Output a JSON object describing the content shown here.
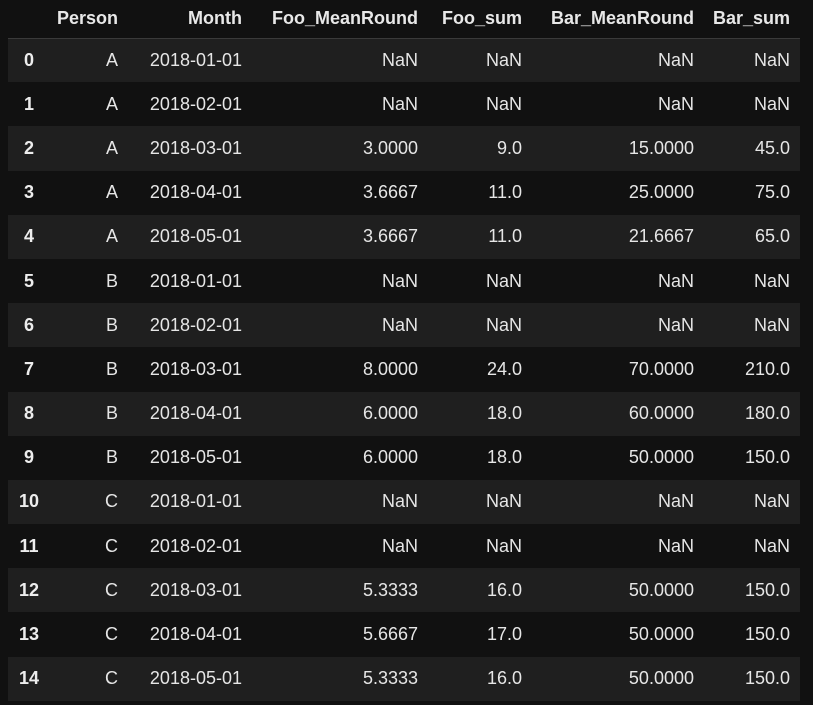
{
  "table": {
    "columns": [
      "",
      "Person",
      "Month",
      "Foo_MeanRound",
      "Foo_sum",
      "Bar_MeanRound",
      "Bar_sum"
    ],
    "rows": [
      {
        "index": "0",
        "cells": [
          "A",
          "2018-01-01",
          "NaN",
          "NaN",
          "NaN",
          "NaN"
        ]
      },
      {
        "index": "1",
        "cells": [
          "A",
          "2018-02-01",
          "NaN",
          "NaN",
          "NaN",
          "NaN"
        ]
      },
      {
        "index": "2",
        "cells": [
          "A",
          "2018-03-01",
          "3.0000",
          "9.0",
          "15.0000",
          "45.0"
        ]
      },
      {
        "index": "3",
        "cells": [
          "A",
          "2018-04-01",
          "3.6667",
          "11.0",
          "25.0000",
          "75.0"
        ]
      },
      {
        "index": "4",
        "cells": [
          "A",
          "2018-05-01",
          "3.6667",
          "11.0",
          "21.6667",
          "65.0"
        ]
      },
      {
        "index": "5",
        "cells": [
          "B",
          "2018-01-01",
          "NaN",
          "NaN",
          "NaN",
          "NaN"
        ]
      },
      {
        "index": "6",
        "cells": [
          "B",
          "2018-02-01",
          "NaN",
          "NaN",
          "NaN",
          "NaN"
        ]
      },
      {
        "index": "7",
        "cells": [
          "B",
          "2018-03-01",
          "8.0000",
          "24.0",
          "70.0000",
          "210.0"
        ]
      },
      {
        "index": "8",
        "cells": [
          "B",
          "2018-04-01",
          "6.0000",
          "18.0",
          "60.0000",
          "180.0"
        ]
      },
      {
        "index": "9",
        "cells": [
          "B",
          "2018-05-01",
          "6.0000",
          "18.0",
          "50.0000",
          "150.0"
        ]
      },
      {
        "index": "10",
        "cells": [
          "C",
          "2018-01-01",
          "NaN",
          "NaN",
          "NaN",
          "NaN"
        ]
      },
      {
        "index": "11",
        "cells": [
          "C",
          "2018-02-01",
          "NaN",
          "NaN",
          "NaN",
          "NaN"
        ]
      },
      {
        "index": "12",
        "cells": [
          "C",
          "2018-03-01",
          "5.3333",
          "16.0",
          "50.0000",
          "150.0"
        ]
      },
      {
        "index": "13",
        "cells": [
          "C",
          "2018-04-01",
          "5.6667",
          "17.0",
          "50.0000",
          "150.0"
        ]
      },
      {
        "index": "14",
        "cells": [
          "C",
          "2018-05-01",
          "5.3333",
          "16.0",
          "50.0000",
          "150.0"
        ]
      }
    ]
  },
  "colors": {
    "background": "#111111",
    "row_alt": "#1f1f1f",
    "text": "#e6e6e6"
  }
}
